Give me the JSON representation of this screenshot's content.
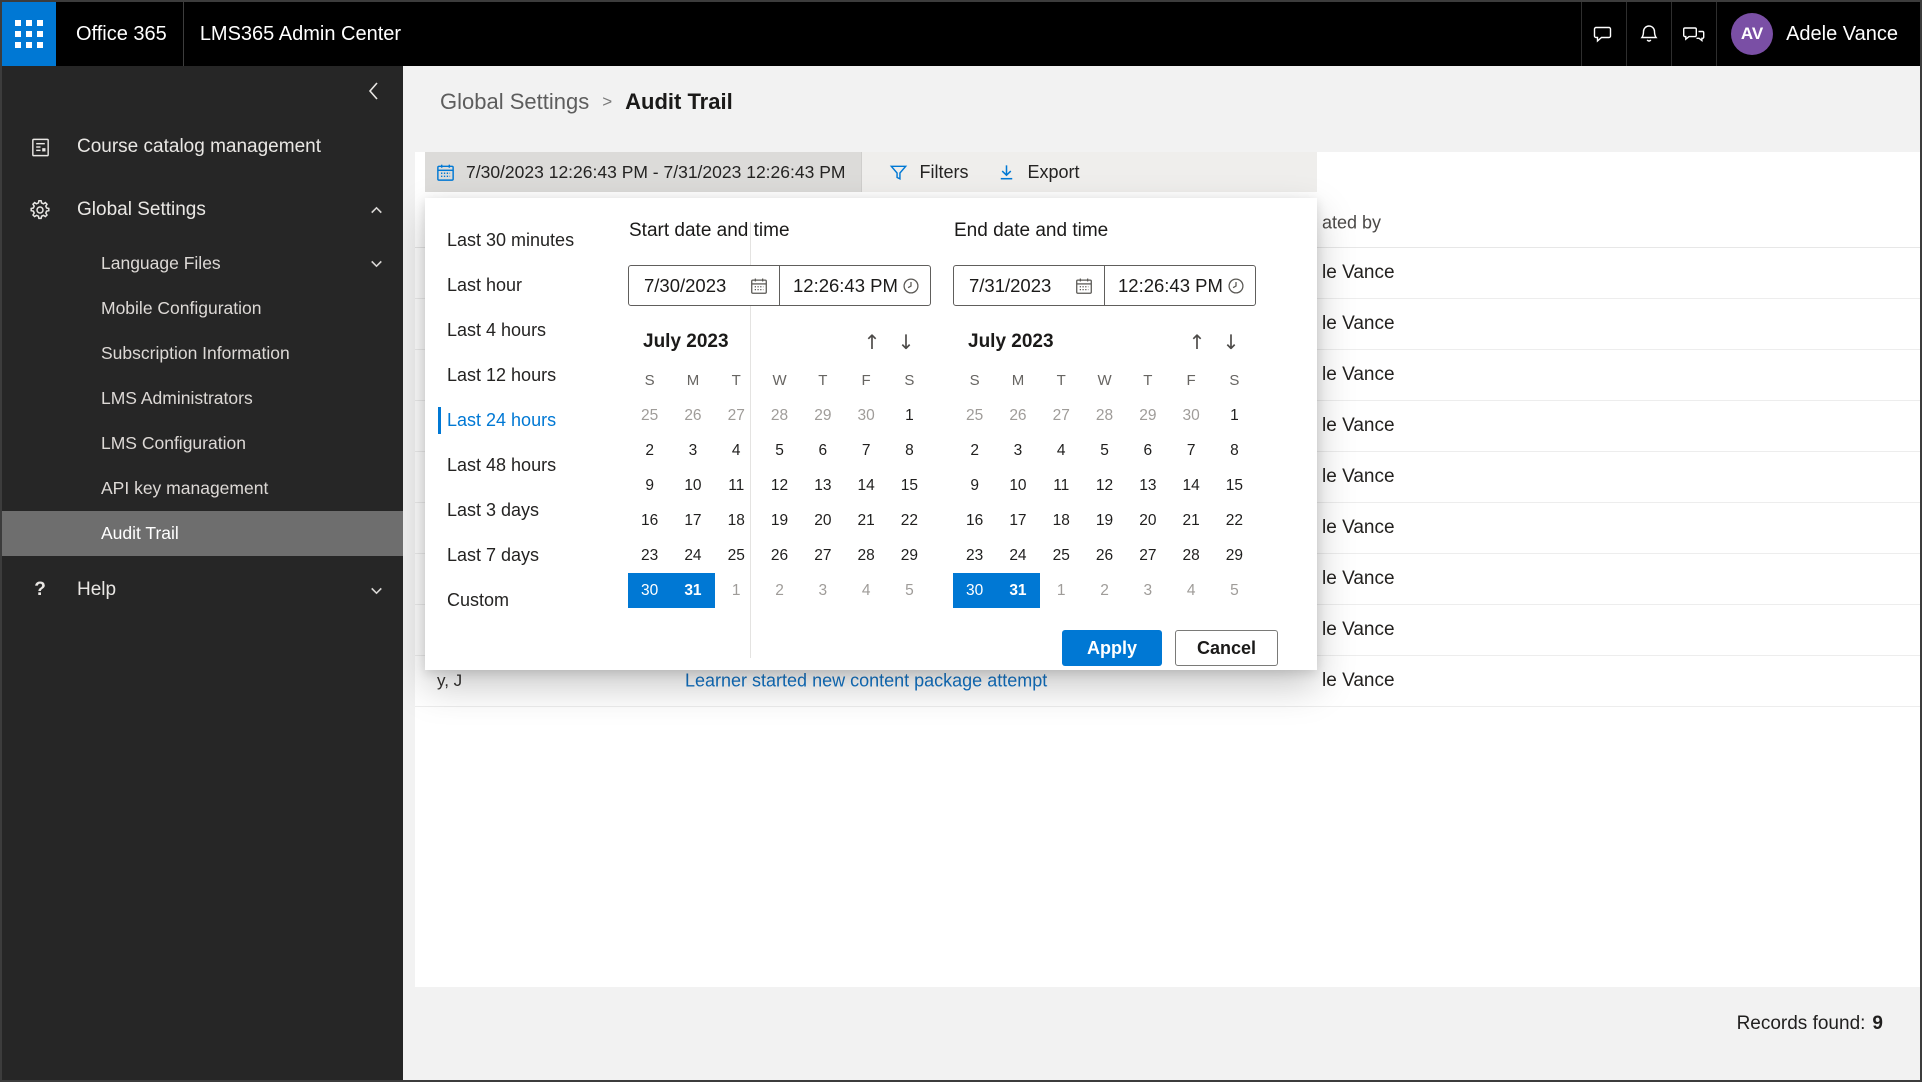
{
  "colors": {
    "accent": "#0078d4",
    "avatar": "#7a4fa5",
    "sidebar_bg": "#262626",
    "selected_item_bg": "#6e6e6e",
    "topbar_bg": "#000000"
  },
  "topbar": {
    "brand": "Office 365",
    "app_title": "LMS365 Admin Center",
    "icons": [
      "chat-icon",
      "bell-icon",
      "feedback-icon"
    ],
    "user": {
      "initials": "AV",
      "name": "Adele Vance"
    }
  },
  "sidebar": {
    "items": [
      {
        "label": "Course catalog management",
        "icon": "catalog-icon"
      },
      {
        "label": "Global Settings",
        "icon": "gear-icon",
        "expanded": true
      }
    ],
    "global_settings_children": [
      {
        "label": "Language Files",
        "chevron": "down"
      },
      {
        "label": "Mobile Configuration"
      },
      {
        "label": "Subscription Information"
      },
      {
        "label": "LMS Administrators"
      },
      {
        "label": "LMS Configuration"
      },
      {
        "label": "API key management"
      },
      {
        "label": "Audit Trail",
        "selected": true
      }
    ],
    "help": {
      "label": "Help",
      "icon_glyph": "?",
      "chevron": "down"
    }
  },
  "breadcrumb": {
    "parent": "Global Settings",
    "separator": ">",
    "current": "Audit Trail"
  },
  "toolbar": {
    "range_icon": "calendar-icon",
    "date_range": "7/30/2023 12:26:43 PM - 7/31/2023 12:26:43 PM",
    "filters_icon": "funnel-icon",
    "filters_label": "Filters",
    "export_icon": "download-icon",
    "export_label": "Export"
  },
  "datepicker": {
    "quick_ranges": [
      "Last 30 minutes",
      "Last hour",
      "Last 4 hours",
      "Last 12 hours",
      "Last 24 hours",
      "Last 48 hours",
      "Last 3 days",
      "Last 7 days",
      "Custom"
    ],
    "selected_range": "Last 24 hours",
    "start": {
      "label": "Start date and time",
      "date": "7/30/2023",
      "time": "12:26:43 PM",
      "date_icon": "calendar-icon",
      "time_icon": "clock-icon"
    },
    "end": {
      "label": "End date and time",
      "date": "7/31/2023",
      "time": "12:26:43 PM",
      "date_icon": "calendar-icon",
      "time_icon": "clock-icon"
    },
    "calendar": {
      "title": "July 2023",
      "nav_icons": [
        "arrow-up-icon",
        "arrow-down-icon"
      ],
      "day_headers": [
        "S",
        "M",
        "T",
        "W",
        "T",
        "F",
        "S"
      ],
      "weeks": [
        [
          {
            "d": 25,
            "out": true
          },
          {
            "d": 26,
            "out": true
          },
          {
            "d": 27,
            "out": true
          },
          {
            "d": 28,
            "out": true
          },
          {
            "d": 29,
            "out": true
          },
          {
            "d": 30,
            "out": true
          },
          {
            "d": 1
          }
        ],
        [
          {
            "d": 2
          },
          {
            "d": 3
          },
          {
            "d": 4
          },
          {
            "d": 5
          },
          {
            "d": 6
          },
          {
            "d": 7
          },
          {
            "d": 8
          }
        ],
        [
          {
            "d": 9
          },
          {
            "d": 10
          },
          {
            "d": 11
          },
          {
            "d": 12
          },
          {
            "d": 13
          },
          {
            "d": 14
          },
          {
            "d": 15
          }
        ],
        [
          {
            "d": 16
          },
          {
            "d": 17
          },
          {
            "d": 18
          },
          {
            "d": 19
          },
          {
            "d": 20
          },
          {
            "d": 21
          },
          {
            "d": 22
          }
        ],
        [
          {
            "d": 23
          },
          {
            "d": 24
          },
          {
            "d": 25
          },
          {
            "d": 26
          },
          {
            "d": 27
          },
          {
            "d": 28
          },
          {
            "d": 29
          }
        ],
        [
          {
            "d": 30,
            "sel": true
          },
          {
            "d": 31,
            "sel": true,
            "bold": true
          },
          {
            "d": 1,
            "out": true
          },
          {
            "d": 2,
            "out": true
          },
          {
            "d": 3,
            "out": true
          },
          {
            "d": 4,
            "out": true
          },
          {
            "d": 5,
            "out": true
          }
        ]
      ],
      "selected_days": [
        30,
        31
      ]
    },
    "apply_label": "Apply",
    "cancel_label": "Cancel"
  },
  "table": {
    "header_visible": "ated by",
    "rows": [
      "le Vance",
      "le Vance",
      "le Vance",
      "le Vance",
      "le Vance",
      "le Vance",
      "le Vance",
      "le Vance",
      "le Vance"
    ],
    "partial_row": {
      "fragment": "y, J",
      "link": "Learner started new content package attempt"
    }
  },
  "footer": {
    "records_label": "Records found:",
    "records_count": "9"
  }
}
